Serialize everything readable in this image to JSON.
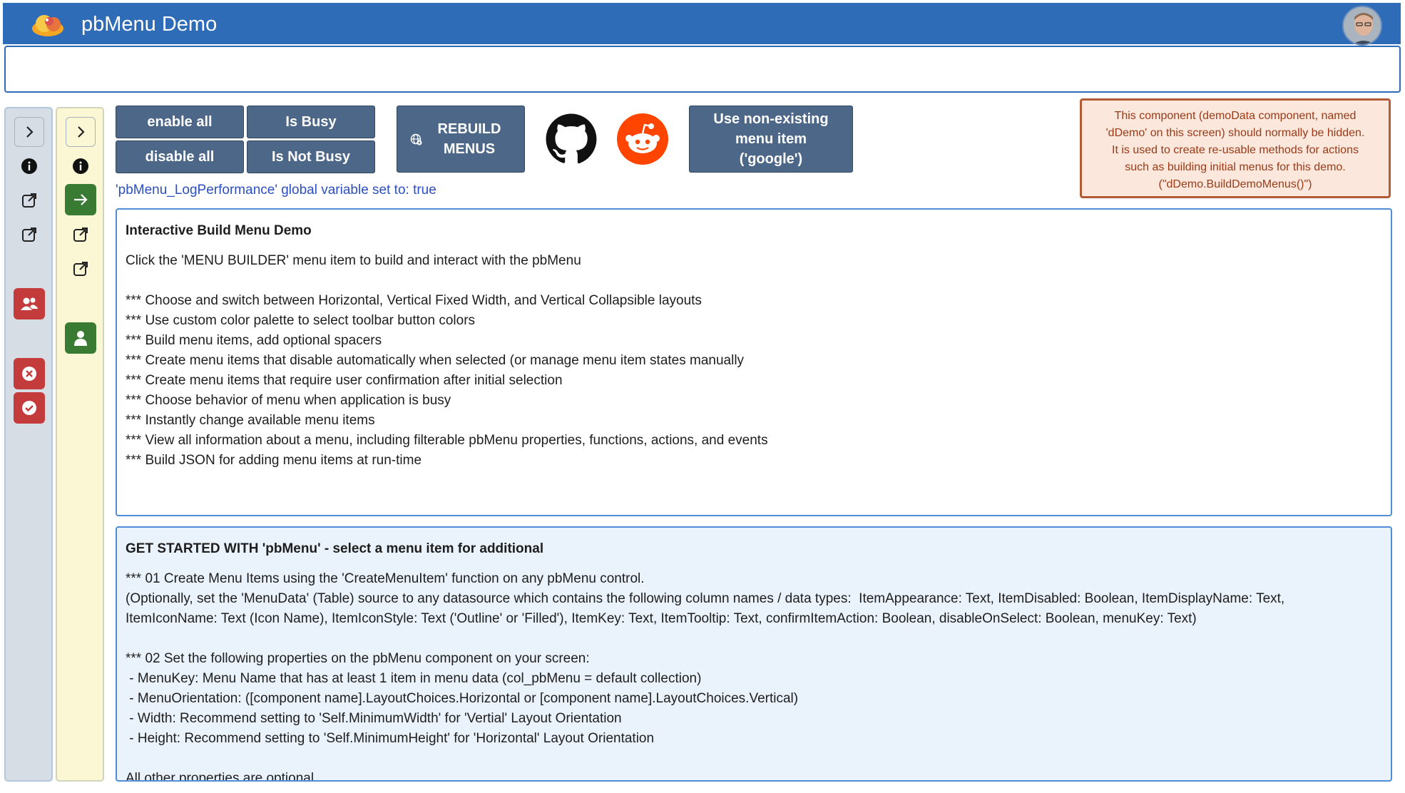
{
  "header": {
    "title": "pbMenu Demo"
  },
  "toolbar": {
    "enable_all": "enable all",
    "is_busy": "Is Busy",
    "disable_all": "disable all",
    "is_not_busy": "Is Not Busy",
    "rebuild_line1": "REBUILD",
    "rebuild_line2": "MENUS",
    "nonexist_line1": "Use non-existing",
    "nonexist_line2": "menu item",
    "nonexist_line3": "('google')"
  },
  "note": {
    "lines": [
      "This component (demoData component, named",
      "'dDemo' on this screen) should normally be hidden.",
      "It is used to create re-usable methods for actions",
      "such as building initial menus for this demo.",
      "(\"dDemo.BuildDemoMenus()\")"
    ]
  },
  "log_line": "'pbMenu_LogPerformance' global variable set to: true",
  "panel1": {
    "title": "Interactive Build Menu Demo",
    "intro": "Click the 'MENU BUILDER' menu item to build and interact with the pbMenu",
    "bullets": [
      "*** Choose and switch between Horizontal, Vertical Fixed Width, and Vertical Collapsible layouts",
      "*** Use custom color palette to select toolbar button colors",
      "*** Build menu items, add optional spacers",
      "*** Create menu items that disable automatically when selected (or manage menu item states manually",
      "*** Create menu items that require user confirmation after initial selection",
      "*** Choose behavior of menu when application is busy",
      "*** Instantly change available menu items",
      "*** View all information about a menu, including filterable pbMenu properties, functions, actions, and events",
      "*** Build JSON for adding menu items at run-time"
    ]
  },
  "panel2": {
    "title": "GET STARTED WITH 'pbMenu' - select a menu item for additional",
    "step1": "*** 01 Create Menu Items using the 'CreateMenuItem' function on any pbMenu control.",
    "step1_note1": "(Optionally, set the 'MenuData' (Table) source to any datasource which contains the following column names / data types:  ItemAppearance: Text, ItemDisabled: Boolean, ItemDisplayName: Text,",
    "step1_note2": "ItemIconName: Text (Icon Name), ItemIconStyle: Text ('Outline' or 'Filled'), ItemKey: Text, ItemTooltip: Text, confirmItemAction: Boolean, disableOnSelect: Boolean, menuKey: Text)",
    "step2": "*** 02 Set the following properties on the pbMenu component on your screen:",
    "props": [
      " - MenuKey: Menu Name that has at least 1 item in menu data (col_pbMenu = default collection)",
      " - MenuOrientation: ([component name].LayoutChoices.Horizontal or [component name].LayoutChoices.Vertical)",
      " - Width: Recommend setting to 'Self.MinimumWidth' for 'Vertial' Layout Orientation",
      " - Height: Recommend setting to 'Self.MinimumHeight' for 'Horizontal' Layout Orientation"
    ],
    "footer": "All other properties are optional"
  },
  "icons": {
    "rail1": [
      "chevron-right-icon",
      "info-icon",
      "external-link-icon",
      "external-link-icon",
      "people-icon",
      "x-circle-icon",
      "check-circle-icon"
    ],
    "rail2": [
      "chevron-right-icon",
      "info-icon",
      "arrow-right-icon",
      "external-link-icon",
      "external-link-icon",
      "person-icon"
    ]
  },
  "colors": {
    "header": "#2e6cb8",
    "button": "#4c6787",
    "rail_red": "#c43b3b",
    "rail_green": "#3a7b33",
    "reddit": "#ff4500",
    "note_bg": "#fbe7dc",
    "note_border": "#b35a36",
    "log_text": "#2b4fc2"
  }
}
